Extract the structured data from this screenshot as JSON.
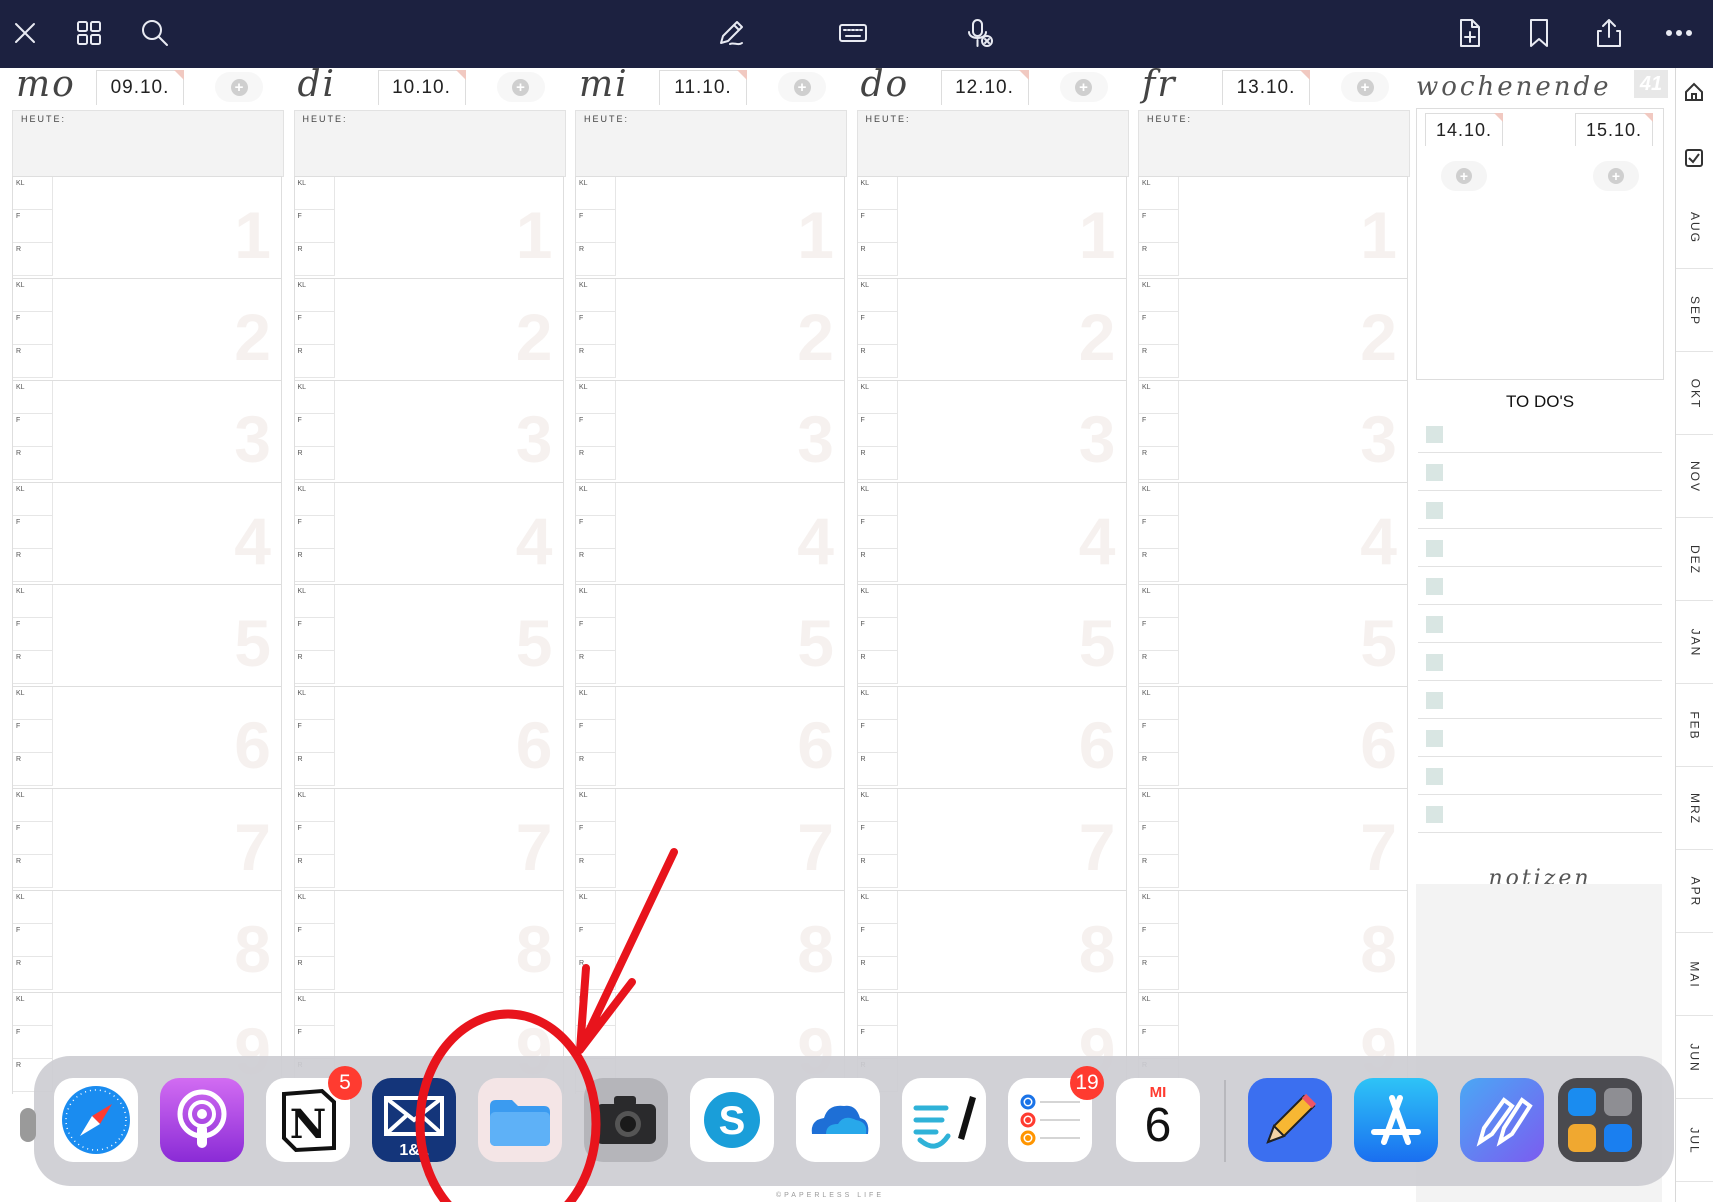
{
  "toolbar": {
    "left_icons": [
      "close-icon",
      "grid-icon",
      "search-icon"
    ],
    "center_icons": [
      "pen-icon",
      "keyboard-icon",
      "microphone-icon"
    ],
    "right_icons": [
      "add-page-icon",
      "bookmark-icon",
      "share-icon",
      "more-icon"
    ]
  },
  "planner": {
    "today_label": "HEUTE:",
    "block_labels": [
      "KL",
      "F",
      "R"
    ],
    "block_numbers": [
      "1",
      "2",
      "3",
      "4",
      "5",
      "6",
      "7",
      "8",
      "9"
    ],
    "days": [
      {
        "name": "mo",
        "date": "09.10."
      },
      {
        "name": "di",
        "date": "10.10."
      },
      {
        "name": "mi",
        "date": "11.10."
      },
      {
        "name": "do",
        "date": "12.10."
      },
      {
        "name": "fr",
        "date": "13.10."
      }
    ],
    "weekend": {
      "title": "wochenende",
      "week_number": "41",
      "dates": [
        "14.10.",
        "15.10."
      ]
    },
    "todo_title": "TO DO'S",
    "todo_count": 11,
    "notes_title": "notizen",
    "footer": "©PAPERLESS LIFE"
  },
  "side_tabs": {
    "icons": [
      "home-icon",
      "checkbox-icon"
    ],
    "months": [
      "AUG",
      "SEP",
      "OKT",
      "NOV",
      "DEZ",
      "JAN",
      "FEB",
      "MRZ",
      "APR",
      "MAI",
      "JUN",
      "JUL"
    ]
  },
  "dock": {
    "apps": [
      {
        "name": "Safari",
        "badge": ""
      },
      {
        "name": "Podcasts",
        "badge": ""
      },
      {
        "name": "Notion",
        "badge": "5"
      },
      {
        "name": "1&1 Mail",
        "badge": ""
      },
      {
        "name": "Files",
        "badge": ""
      },
      {
        "name": "Camera",
        "badge": ""
      },
      {
        "name": "Skype",
        "badge": ""
      },
      {
        "name": "OneDrive",
        "badge": ""
      },
      {
        "name": "Notability",
        "badge": ""
      },
      {
        "name": "Reminders",
        "badge": "19"
      },
      {
        "name": "Calendar",
        "badge": "",
        "weekday": "MI",
        "day": "6"
      },
      {
        "name": "Pencil Planner",
        "badge": ""
      },
      {
        "name": "App Store",
        "badge": ""
      },
      {
        "name": "Pencil Kit",
        "badge": ""
      },
      {
        "name": "App Library",
        "badge": ""
      }
    ]
  },
  "colors": {
    "toolbar_bg": "#1c2140",
    "annotation_red": "#e8141c",
    "badge_red": "#ff3b30"
  }
}
